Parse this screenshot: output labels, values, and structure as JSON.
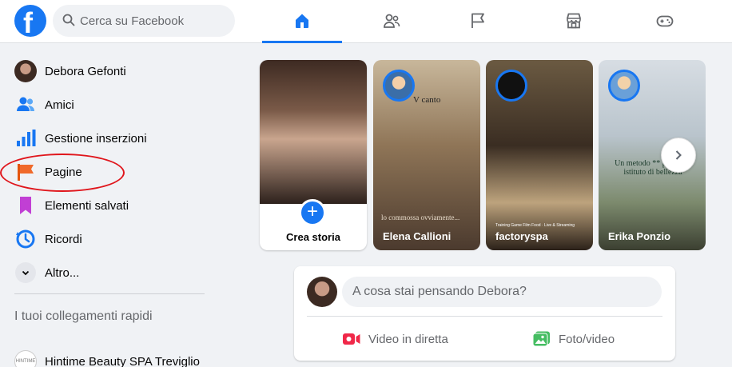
{
  "search": {
    "placeholder": "Cerca su Facebook"
  },
  "logo": {
    "letter": "f"
  },
  "nav": {
    "tabs": [
      "home",
      "friends",
      "pages",
      "marketplace",
      "gaming"
    ]
  },
  "sidebar": {
    "items": [
      {
        "label": "Debora Gefonti",
        "icon": "profile-avatar"
      },
      {
        "label": "Amici",
        "icon": "friends-icon"
      },
      {
        "label": "Gestione inserzioni",
        "icon": "ads-manager-icon"
      },
      {
        "label": "Pagine",
        "icon": "flag-icon"
      },
      {
        "label": "Elementi salvati",
        "icon": "bookmark-icon"
      },
      {
        "label": "Ricordi",
        "icon": "memories-clock-icon"
      },
      {
        "label": "Altro...",
        "icon": "chevron-down-icon"
      }
    ],
    "shortcuts_title": "I tuoi collegamenti rapidi",
    "shortcuts": [
      {
        "label": "Hintime Beauty SPA Treviglio",
        "badge": "HINTIME"
      }
    ]
  },
  "stories": {
    "create_label": "Crea storia",
    "items": [
      {
        "name": "Elena Callioni",
        "overlay_top": "V canto",
        "overlay_bottom": "lo commossa ovviamente..."
      },
      {
        "name": "factoryspa",
        "overlay_bottom": "Training Game Film Food · Live & Streaming"
      },
      {
        "name": "Erika Ponzio",
        "overlay_text": "Un metodo ** per il tuo istituto di bellezza"
      }
    ]
  },
  "composer": {
    "placeholder": "A cosa stai pensando Debora?",
    "live_label": "Video in diretta",
    "photo_label": "Foto/video"
  },
  "colors": {
    "accent": "#1877f2",
    "live": "#f02849",
    "photo": "#45bd62",
    "annotation": "#e0161c"
  }
}
